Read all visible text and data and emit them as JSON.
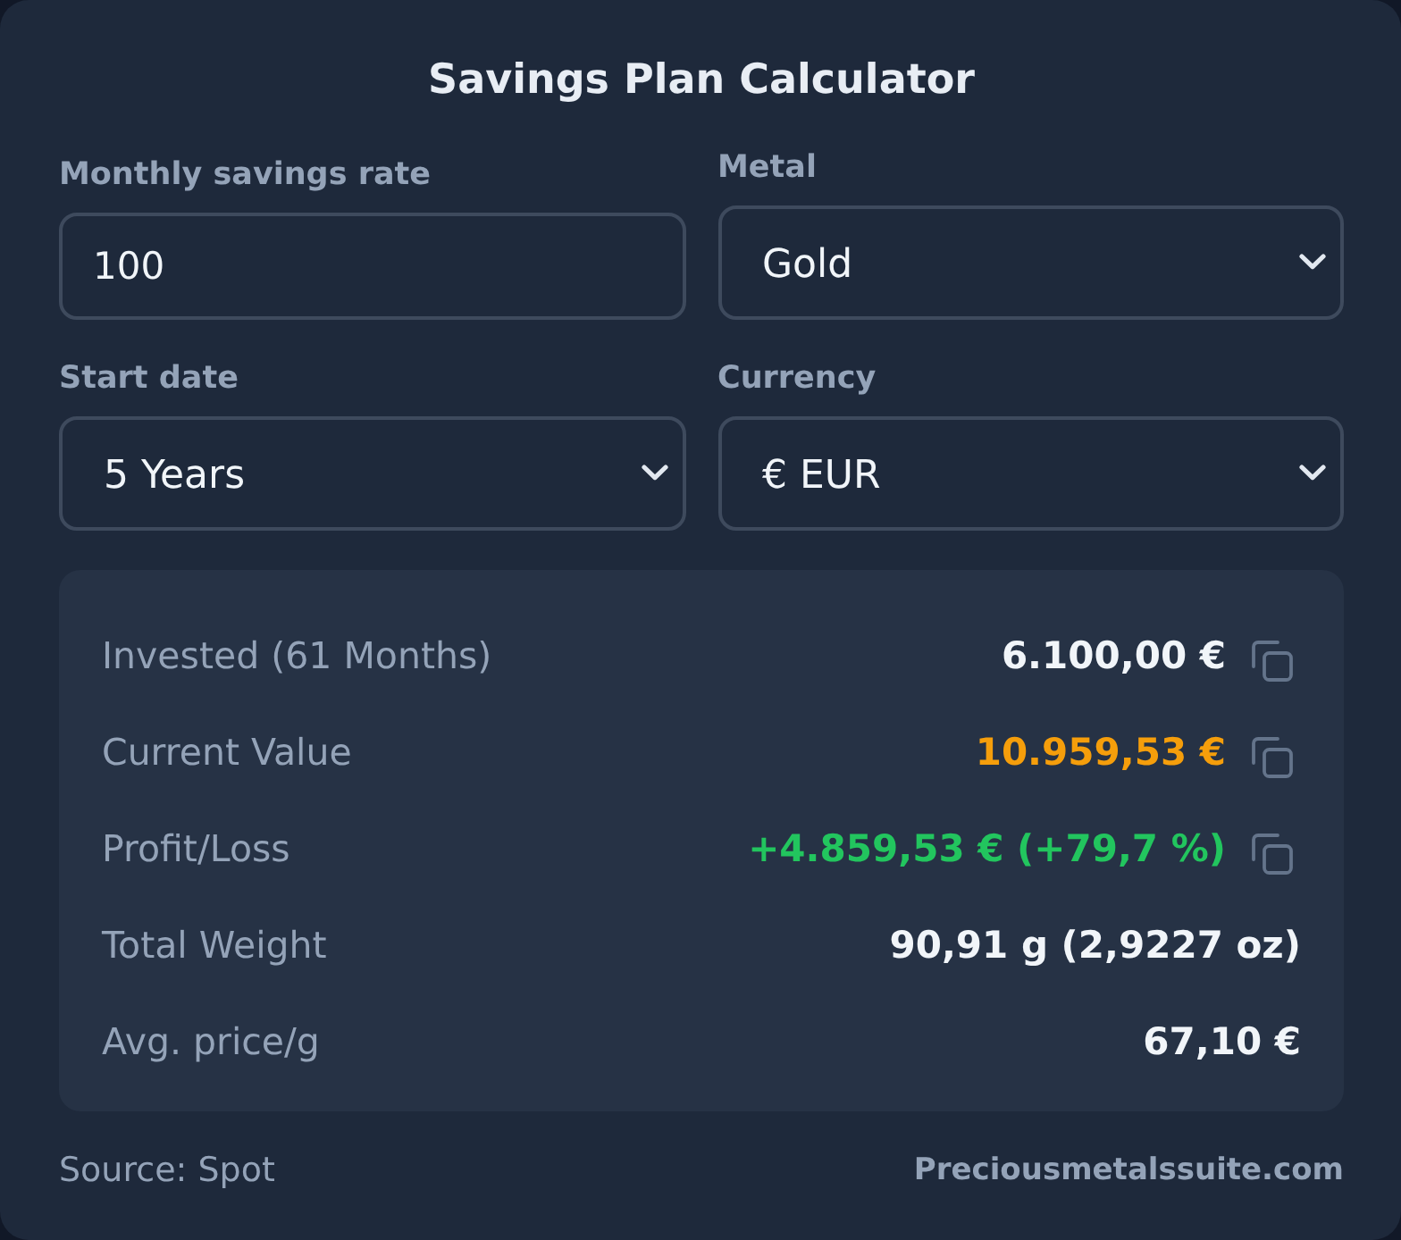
{
  "title": "Savings Plan Calculator",
  "fields": [
    {
      "kind": "input",
      "label": "Monthly savings rate",
      "value": "100"
    },
    {
      "kind": "select",
      "label": "Metal",
      "value": "Gold"
    },
    {
      "kind": "select",
      "label": "Start date",
      "value": "5 Years"
    },
    {
      "kind": "select",
      "label": "Currency",
      "value": "€ EUR"
    }
  ],
  "results": [
    {
      "label": "Invested (61 Months)",
      "value": "6.100,00 €",
      "color": "#f1f5f9",
      "copyable": true
    },
    {
      "label": "Current Value",
      "value": "10.959,53 €",
      "color": "#f59e0b",
      "copyable": true
    },
    {
      "label": "Profit/Loss",
      "value": "+4.859,53 € (+79,7 %)",
      "color": "#22c55e",
      "copyable": true
    },
    {
      "label": "Total Weight",
      "value": "90,91 g (2,9227 oz)",
      "color": "#f1f5f9",
      "copyable": false
    },
    {
      "label": "Avg. price/g",
      "value": "67,10 €",
      "color": "#f1f5f9",
      "copyable": false
    }
  ],
  "footer": {
    "source": "Source: Spot",
    "brand": "Preciousmetalssuite.com"
  }
}
